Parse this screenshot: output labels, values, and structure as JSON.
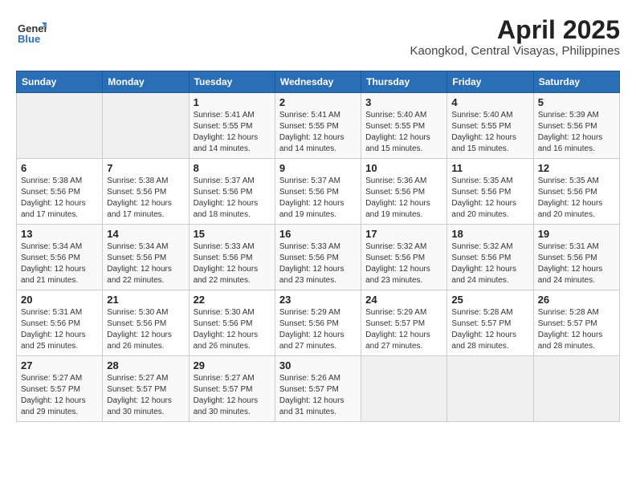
{
  "header": {
    "logo_general": "General",
    "logo_blue": "Blue",
    "month_title": "April 2025",
    "location": "Kaongkod, Central Visayas, Philippines"
  },
  "calendar": {
    "weekdays": [
      "Sunday",
      "Monday",
      "Tuesday",
      "Wednesday",
      "Thursday",
      "Friday",
      "Saturday"
    ],
    "weeks": [
      [
        {
          "day": "",
          "info": ""
        },
        {
          "day": "",
          "info": ""
        },
        {
          "day": "1",
          "info": "Sunrise: 5:41 AM\nSunset: 5:55 PM\nDaylight: 12 hours\nand 14 minutes."
        },
        {
          "day": "2",
          "info": "Sunrise: 5:41 AM\nSunset: 5:55 PM\nDaylight: 12 hours\nand 14 minutes."
        },
        {
          "day": "3",
          "info": "Sunrise: 5:40 AM\nSunset: 5:55 PM\nDaylight: 12 hours\nand 15 minutes."
        },
        {
          "day": "4",
          "info": "Sunrise: 5:40 AM\nSunset: 5:55 PM\nDaylight: 12 hours\nand 15 minutes."
        },
        {
          "day": "5",
          "info": "Sunrise: 5:39 AM\nSunset: 5:56 PM\nDaylight: 12 hours\nand 16 minutes."
        }
      ],
      [
        {
          "day": "6",
          "info": "Sunrise: 5:38 AM\nSunset: 5:56 PM\nDaylight: 12 hours\nand 17 minutes."
        },
        {
          "day": "7",
          "info": "Sunrise: 5:38 AM\nSunset: 5:56 PM\nDaylight: 12 hours\nand 17 minutes."
        },
        {
          "day": "8",
          "info": "Sunrise: 5:37 AM\nSunset: 5:56 PM\nDaylight: 12 hours\nand 18 minutes."
        },
        {
          "day": "9",
          "info": "Sunrise: 5:37 AM\nSunset: 5:56 PM\nDaylight: 12 hours\nand 19 minutes."
        },
        {
          "day": "10",
          "info": "Sunrise: 5:36 AM\nSunset: 5:56 PM\nDaylight: 12 hours\nand 19 minutes."
        },
        {
          "day": "11",
          "info": "Sunrise: 5:35 AM\nSunset: 5:56 PM\nDaylight: 12 hours\nand 20 minutes."
        },
        {
          "day": "12",
          "info": "Sunrise: 5:35 AM\nSunset: 5:56 PM\nDaylight: 12 hours\nand 20 minutes."
        }
      ],
      [
        {
          "day": "13",
          "info": "Sunrise: 5:34 AM\nSunset: 5:56 PM\nDaylight: 12 hours\nand 21 minutes."
        },
        {
          "day": "14",
          "info": "Sunrise: 5:34 AM\nSunset: 5:56 PM\nDaylight: 12 hours\nand 22 minutes."
        },
        {
          "day": "15",
          "info": "Sunrise: 5:33 AM\nSunset: 5:56 PM\nDaylight: 12 hours\nand 22 minutes."
        },
        {
          "day": "16",
          "info": "Sunrise: 5:33 AM\nSunset: 5:56 PM\nDaylight: 12 hours\nand 23 minutes."
        },
        {
          "day": "17",
          "info": "Sunrise: 5:32 AM\nSunset: 5:56 PM\nDaylight: 12 hours\nand 23 minutes."
        },
        {
          "day": "18",
          "info": "Sunrise: 5:32 AM\nSunset: 5:56 PM\nDaylight: 12 hours\nand 24 minutes."
        },
        {
          "day": "19",
          "info": "Sunrise: 5:31 AM\nSunset: 5:56 PM\nDaylight: 12 hours\nand 24 minutes."
        }
      ],
      [
        {
          "day": "20",
          "info": "Sunrise: 5:31 AM\nSunset: 5:56 PM\nDaylight: 12 hours\nand 25 minutes."
        },
        {
          "day": "21",
          "info": "Sunrise: 5:30 AM\nSunset: 5:56 PM\nDaylight: 12 hours\nand 26 minutes."
        },
        {
          "day": "22",
          "info": "Sunrise: 5:30 AM\nSunset: 5:56 PM\nDaylight: 12 hours\nand 26 minutes."
        },
        {
          "day": "23",
          "info": "Sunrise: 5:29 AM\nSunset: 5:56 PM\nDaylight: 12 hours\nand 27 minutes."
        },
        {
          "day": "24",
          "info": "Sunrise: 5:29 AM\nSunset: 5:57 PM\nDaylight: 12 hours\nand 27 minutes."
        },
        {
          "day": "25",
          "info": "Sunrise: 5:28 AM\nSunset: 5:57 PM\nDaylight: 12 hours\nand 28 minutes."
        },
        {
          "day": "26",
          "info": "Sunrise: 5:28 AM\nSunset: 5:57 PM\nDaylight: 12 hours\nand 28 minutes."
        }
      ],
      [
        {
          "day": "27",
          "info": "Sunrise: 5:27 AM\nSunset: 5:57 PM\nDaylight: 12 hours\nand 29 minutes."
        },
        {
          "day": "28",
          "info": "Sunrise: 5:27 AM\nSunset: 5:57 PM\nDaylight: 12 hours\nand 30 minutes."
        },
        {
          "day": "29",
          "info": "Sunrise: 5:27 AM\nSunset: 5:57 PM\nDaylight: 12 hours\nand 30 minutes."
        },
        {
          "day": "30",
          "info": "Sunrise: 5:26 AM\nSunset: 5:57 PM\nDaylight: 12 hours\nand 31 minutes."
        },
        {
          "day": "",
          "info": ""
        },
        {
          "day": "",
          "info": ""
        },
        {
          "day": "",
          "info": ""
        }
      ]
    ]
  }
}
